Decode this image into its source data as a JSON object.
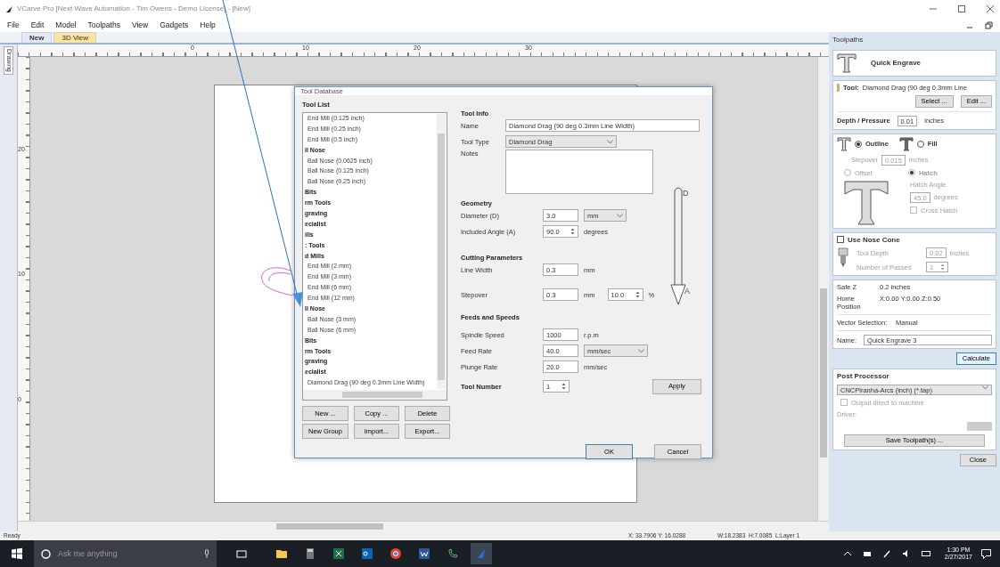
{
  "window": {
    "title": "VCarve Pro [Next Wave Automation - Tim Owens - Demo License] - [New]"
  },
  "menu": [
    "File",
    "Edit",
    "Model",
    "Toolpaths",
    "View",
    "Gadgets",
    "Help"
  ],
  "side_tab": "Drawing",
  "doc_tabs": [
    {
      "label": "New",
      "selected": true
    },
    {
      "label": "3D View",
      "selected": false
    }
  ],
  "ruler": {
    "x_labels": [
      "0",
      "10",
      "20",
      "30"
    ],
    "y_labels": [
      "20",
      "10",
      "0"
    ]
  },
  "dialog": {
    "title": "Tool Database",
    "list_title": "Tool List",
    "tools": [
      {
        "kind": "tool",
        "label": "End Mill (0.125 inch)"
      },
      {
        "kind": "tool",
        "label": "End Mill (0.25 inch)"
      },
      {
        "kind": "tool",
        "label": "End Mill (0.5 inch)"
      },
      {
        "kind": "group",
        "label": "ll Nose"
      },
      {
        "kind": "tool",
        "label": "Ball Nose (0.0625 inch)"
      },
      {
        "kind": "tool",
        "label": "Ball Nose (0.125 inch)"
      },
      {
        "kind": "tool",
        "label": "Ball Nose (0.25 inch)"
      },
      {
        "kind": "group",
        "label": "Bits"
      },
      {
        "kind": "group",
        "label": "rm Tools"
      },
      {
        "kind": "group",
        "label": "graving"
      },
      {
        "kind": "group",
        "label": "ecialist"
      },
      {
        "kind": "group",
        "label": "ills"
      },
      {
        "kind": "group",
        "label": ": Tools"
      },
      {
        "kind": "group",
        "label": "d Mills"
      },
      {
        "kind": "tool",
        "label": "End Mill (2 mm)"
      },
      {
        "kind": "tool",
        "label": "End Mill (3 mm)"
      },
      {
        "kind": "tool",
        "label": "End Mill (6 mm)"
      },
      {
        "kind": "tool",
        "label": "End Mill (12 mm)"
      },
      {
        "kind": "group",
        "label": "ll Nose"
      },
      {
        "kind": "tool",
        "label": "Ball Nose (3 mm)"
      },
      {
        "kind": "tool",
        "label": "Ball Nose (6 mm)"
      },
      {
        "kind": "group",
        "label": "Bits"
      },
      {
        "kind": "group",
        "label": "rm Tools"
      },
      {
        "kind": "group",
        "label": "graving"
      },
      {
        "kind": "group",
        "label": "ecialist"
      },
      {
        "kind": "tool",
        "label": "Diamond Drag (90 deg 0.3mm Line Width)"
      }
    ],
    "list_buttons": [
      "New ...",
      "Copy ...",
      "Delete",
      "New Group",
      "Import...",
      "Export..."
    ],
    "info_title": "Tool Info",
    "name_label": "Name",
    "name_value": "Diamond Drag (90 deg 0.3mm Line Width)",
    "type_label": "Tool Type",
    "type_value": "Diamond Drag",
    "notes_label": "Notes",
    "geometry_title": "Geometry",
    "diameter_label": "Diameter (D)",
    "diameter_value": "3.0",
    "diameter_unit": "mm",
    "angle_label": "Included Angle (A)",
    "angle_value": "90.0",
    "angle_unit": "degrees",
    "diagram_labels": [
      "D",
      "A"
    ],
    "cutting_title": "Cutting Parameters",
    "line_width_label": "Line Width",
    "line_width_value": "0.3",
    "line_width_unit": "mm",
    "stepover_label": "Stepover",
    "stepover_value": "0.3",
    "stepover_unit": "mm",
    "stepover_percent": "10.0",
    "percent_sign": "%",
    "feeds_title": "Feeds and Speeds",
    "spindle_label": "Spindle Speed",
    "spindle_value": "1000",
    "spindle_unit": "r.p.m",
    "feed_label": "Feed Rate",
    "feed_value": "40.0",
    "feed_unit": "mm/sec",
    "plunge_label": "Plunge Rate",
    "plunge_value": "20.0",
    "plunge_unit": "mm/sec",
    "tool_number_label": "Tool Number",
    "tool_number_value": "1",
    "apply": "Apply",
    "ok": "OK",
    "cancel": "Cancel"
  },
  "toolpaths_panel": {
    "title": "Toolpaths",
    "heading": "Quick Engrave",
    "tool_label": "Tool:",
    "tool_value": "Diamond Drag (90 deg 0.3mm Line",
    "select": "Select ...",
    "edit": "Edit ...",
    "depth_label": "Depth / Pressure",
    "depth_value": "0.01",
    "depth_unit": "inches",
    "fill_modes": [
      {
        "label": "Outline",
        "selected": true
      },
      {
        "label": "Fill",
        "selected": false
      }
    ],
    "stepover_label": "Stepover",
    "stepover_value": "0.015",
    "stepover_unit": "inches",
    "hatch_modes": [
      {
        "label": "Offset",
        "selected": false
      },
      {
        "label": "Hatch",
        "selected": true
      }
    ],
    "hatch_angle_label": "Hatch Angle",
    "hatch_angle_value": "45.0",
    "hatch_angle_unit": "degrees",
    "cross_hatch": {
      "label": "Cross Hatch",
      "checked": false
    },
    "nose_cone": {
      "label": "Use Nose Cone",
      "checked": false
    },
    "tool_depth_label": "Tool Depth",
    "tool_depth_value": "0.02",
    "tool_depth_unit": "inches",
    "passes_label": "Number of Passes",
    "passes_value": "1",
    "safe_z_label": "Safe Z",
    "safe_z_value": "0.2 inches",
    "home_label": "Home Position",
    "home_value": "X:0.00 Y:0.00 Z:0.50",
    "vector_label": "Vector Selection:",
    "vector_value": "Manual",
    "name_label": "Name:",
    "name_value": "Quick Engrave 3",
    "calculate": "Calculate",
    "post_title": "Post Processor",
    "post_value": "CNCPiranha-Arcs (inch) (*.tap)",
    "output_direct": {
      "label": "Output direct to machine",
      "checked": false
    },
    "driver_label": "Driver:",
    "save": "Save Toolpath(s) ...",
    "close": "Close"
  },
  "status_bar": {
    "message": "Ready",
    "cursor": "X: 33.7906 Y: 16.0288",
    "selection": "W:18.2383  H:7.0085  L:Layer 1"
  },
  "taskbar": {
    "search_placeholder": "Ask me anything",
    "time": "1:30 PM",
    "date": "2/27/2017"
  }
}
